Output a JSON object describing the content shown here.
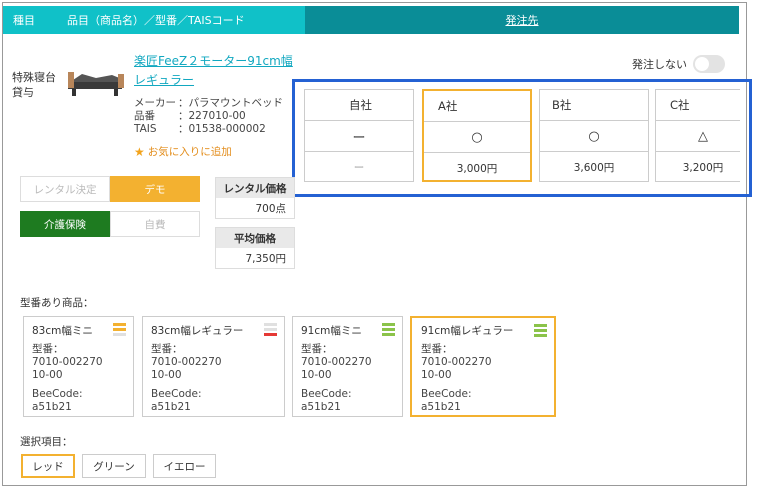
{
  "header": {
    "col_type": "種目",
    "col_item": "品目（商品名）／型番／TAISコード",
    "col_order": "発注先"
  },
  "product": {
    "category": [
      "特殊寝台",
      "貸与"
    ],
    "name": [
      "楽匠FeeZ２モーター91cm幅",
      "レギュラー"
    ],
    "info": [
      {
        "key": "メーカー",
        "value": "：パラマウントベッド"
      },
      {
        "key": "品番",
        "value": "：227010-00"
      },
      {
        "key": "TAIS",
        "value": "：01538-000002"
      }
    ],
    "favorite": "お気に入りに追加"
  },
  "no_order": {
    "label": "発注しない",
    "on": false
  },
  "suppliers": [
    {
      "name": "自社",
      "mark": "ー",
      "price": "ー",
      "selected": false
    },
    {
      "name": "A社",
      "mark": "○",
      "price": "3,000円",
      "selected": true
    },
    {
      "name": "B社",
      "mark": "○",
      "price": "3,600円",
      "selected": false
    },
    {
      "name": "C社",
      "mark": "△",
      "price": "3,200円",
      "selected": false
    }
  ],
  "rental": {
    "seg1": [
      "レンタル決定",
      "デモ"
    ],
    "seg2": [
      "介護保険",
      "自費"
    ],
    "price_label": "レンタル価格",
    "price_value": "700点",
    "avg_label": "平均価格",
    "avg_value": "7,350円"
  },
  "models_label": "型番あり商品：",
  "models": [
    {
      "title": "83cm幅ミニ",
      "model_label": "型番：",
      "model": [
        "7010-002270",
        "10-00"
      ],
      "bee_label": "BeeCode:",
      "bee": "a51b21",
      "stock": [
        "#f3b130",
        "#f3b130",
        "#e0e0e0"
      ],
      "selected": false
    },
    {
      "title": "83cm幅レギュラー",
      "model_label": "型番：",
      "model": [
        "7010-002270",
        "10-00"
      ],
      "bee_label": "BeeCode:",
      "bee": "a51b21",
      "stock": [
        "#e0e0e0",
        "#e0e0e0",
        "#e53935"
      ],
      "selected": false
    },
    {
      "title": "91cm幅ミニ",
      "model_label": "型番：",
      "model": [
        "7010-002270",
        "10-00"
      ],
      "bee_label": "BeeCode:",
      "bee": "a51b21",
      "stock": [
        "#8bc34a",
        "#8bc34a",
        "#8bc34a"
      ],
      "selected": false
    },
    {
      "title": "91cm幅レギュラー",
      "model_label": "型番：",
      "model": [
        "7010-002270",
        "10-00"
      ],
      "bee_label": "BeeCode:",
      "bee": "a51b21",
      "stock": [
        "#8bc34a",
        "#8bc34a",
        "#8bc34a"
      ],
      "selected": true
    }
  ],
  "options_label": "選択項目：",
  "options": [
    {
      "label": "レッド",
      "selected": true
    },
    {
      "label": "グリーン",
      "selected": false
    },
    {
      "label": "イエロー",
      "selected": false
    }
  ],
  "colors": {
    "teal": "#10c1c8",
    "dark_teal": "#0a8d97",
    "accent": "#f3b130",
    "green": "#1e7b20",
    "highlight": "#2461d3"
  }
}
